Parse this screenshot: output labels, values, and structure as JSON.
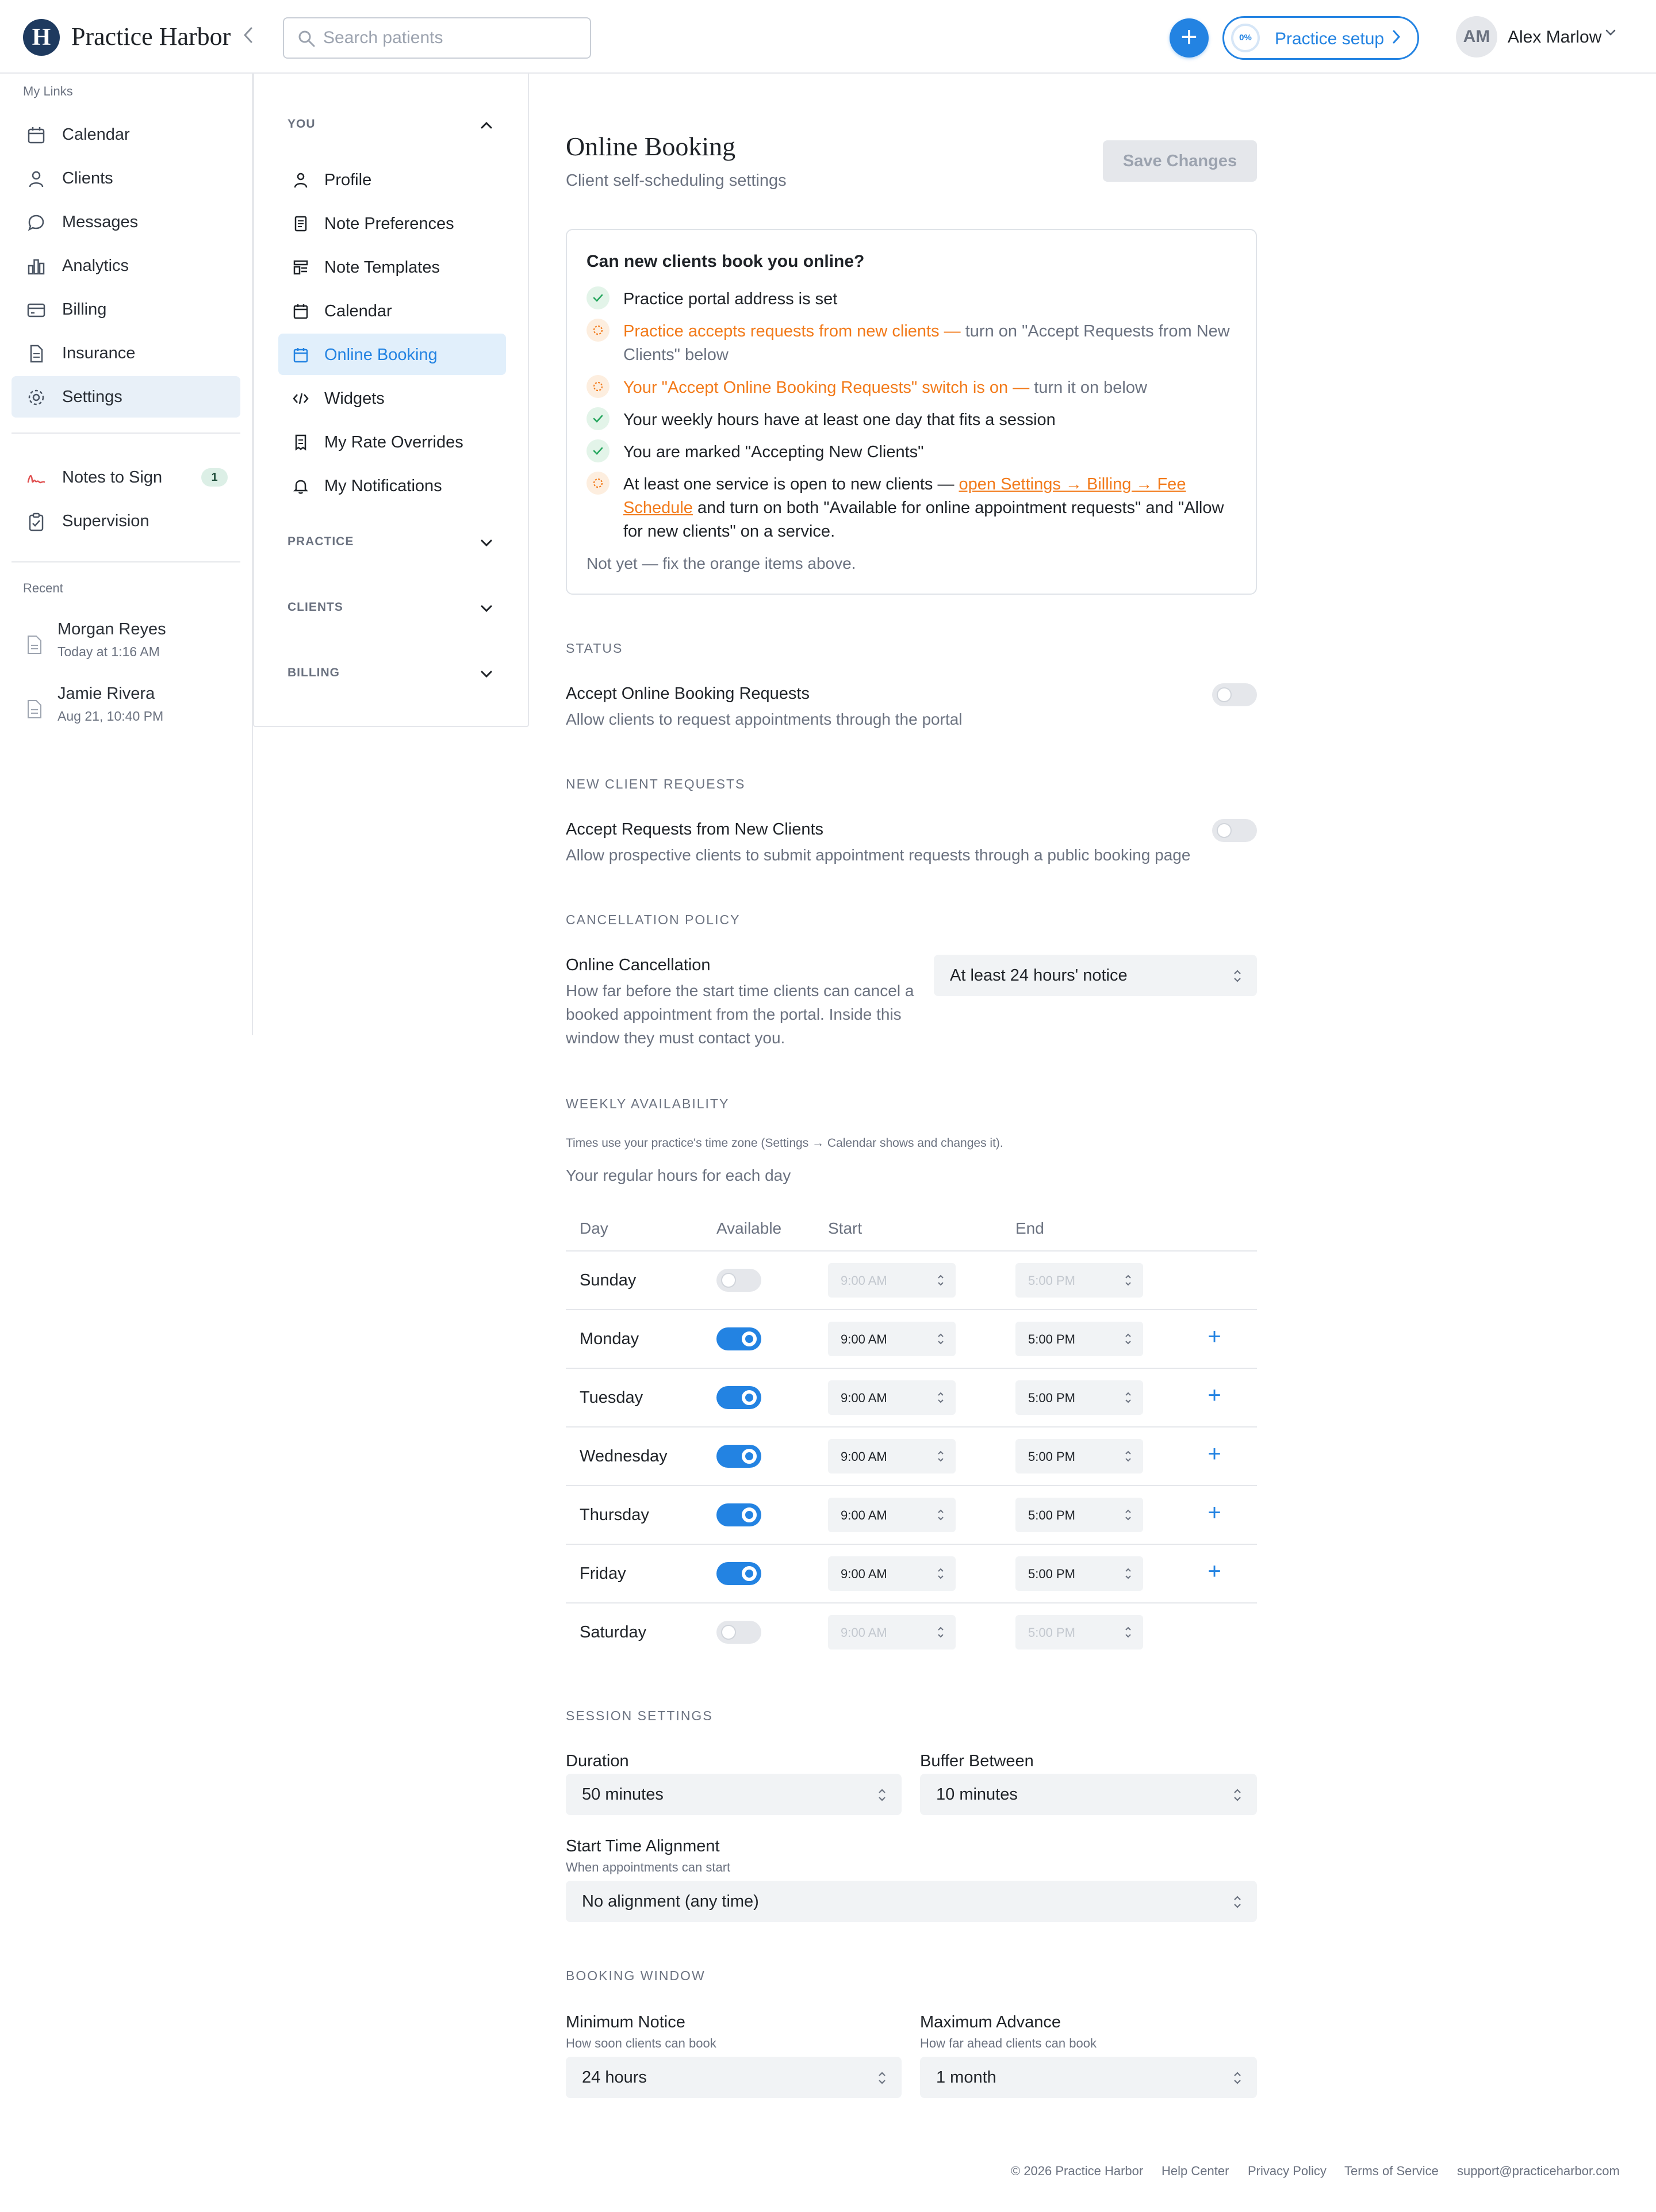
{
  "app": {
    "brand": "Practice Harbor",
    "logo_letter": "H",
    "search_placeholder": "Search patients",
    "add_button": "+",
    "setup": {
      "progress": "0%",
      "label": "Practice setup"
    },
    "user": {
      "initials": "AM",
      "name": "Alex Marlow"
    }
  },
  "sidebar": {
    "heading": "My Links",
    "items": [
      {
        "label": "Calendar",
        "icon": "calendar-icon"
      },
      {
        "label": "Clients",
        "icon": "person-icon"
      },
      {
        "label": "Messages",
        "icon": "chat-bubble-icon"
      },
      {
        "label": "Analytics",
        "icon": "bar-chart-icon"
      },
      {
        "label": "Billing",
        "icon": "credit-card-icon"
      },
      {
        "label": "Insurance",
        "icon": "document-icon"
      },
      {
        "label": "Settings",
        "icon": "gear-icon",
        "active": true
      }
    ],
    "secondary": [
      {
        "label": "Notes to Sign",
        "icon": "signature-icon",
        "badge": "1"
      },
      {
        "label": "Supervision",
        "icon": "clipboard-check-icon"
      }
    ],
    "recent_heading": "Recent",
    "recent": [
      {
        "name": "Morgan Reyes",
        "time": "Today at 1:16 AM"
      },
      {
        "name": "Jamie Rivera",
        "time": "Aug 21, 10:40 PM"
      }
    ]
  },
  "subnav": {
    "sections": {
      "you": "YOU",
      "practice": "PRACTICE",
      "clients": "CLIENTS",
      "billing": "BILLING"
    },
    "items": [
      {
        "label": "Profile",
        "icon": "person-icon"
      },
      {
        "label": "Note Preferences",
        "icon": "note-icon"
      },
      {
        "label": "Note Templates",
        "icon": "template-icon"
      },
      {
        "label": "Calendar",
        "icon": "calendar-icon"
      },
      {
        "label": "Online Booking",
        "icon": "calendar-icon",
        "active": true
      },
      {
        "label": "Widgets",
        "icon": "code-icon"
      },
      {
        "label": "My Rate Overrides",
        "icon": "receipt-icon"
      },
      {
        "label": "My Notifications",
        "icon": "bell-icon"
      }
    ]
  },
  "page": {
    "title": "Online Booking",
    "subtitle": "Client self-scheduling settings",
    "save_label": "Save Changes"
  },
  "checklist": {
    "title": "Can new clients book you online?",
    "items": {
      "portal": "Practice portal address is set",
      "requests_warn": "Practice accepts requests from new clients —",
      "requests_hint": " turn on \"Accept Requests from New Clients\" below",
      "switch_warn": "Your \"Accept Online Booking Requests\" switch is on —",
      "switch_hint": " turn it on below",
      "hours": "Your weekly hours have at least one day that fits a session",
      "accepting": "You are marked \"Accepting New Clients\"",
      "service_warn": "At least one service is open to new clients — ",
      "service_link": "open Settings → Billing → Fee Schedule",
      "service_tail": " and turn on both \"Available for online appointment requests\" and \"Allow for new clients\" on a service."
    },
    "footer": "Not yet — fix the orange items above."
  },
  "status": {
    "heading": "STATUS",
    "label": "Accept Online Booking Requests",
    "desc": "Allow clients to request appointments through the portal",
    "enabled": false
  },
  "new_client": {
    "heading": "NEW CLIENT REQUESTS",
    "label": "Accept Requests from New Clients",
    "desc": "Allow prospective clients to submit appointment requests through a public booking page",
    "enabled": false
  },
  "cancellation": {
    "heading": "CANCELLATION POLICY",
    "label": "Online Cancellation",
    "desc": "How far before the start time clients can cancel a booked appointment from the portal. Inside this window they must contact you.",
    "value": "At least 24 hours' notice"
  },
  "availability": {
    "heading": "WEEKLY AVAILABILITY",
    "note": "Times use your practice's time zone (Settings → Calendar shows and changes it).",
    "subheading": "Your regular hours for each day",
    "columns": {
      "day": "Day",
      "available": "Available",
      "start": "Start",
      "end": "End"
    },
    "days": [
      {
        "name": "Sunday",
        "on": false,
        "start": "9:00 AM",
        "end": "5:00 PM"
      },
      {
        "name": "Monday",
        "on": true,
        "start": "9:00 AM",
        "end": "5:00 PM"
      },
      {
        "name": "Tuesday",
        "on": true,
        "start": "9:00 AM",
        "end": "5:00 PM"
      },
      {
        "name": "Wednesday",
        "on": true,
        "start": "9:00 AM",
        "end": "5:00 PM"
      },
      {
        "name": "Thursday",
        "on": true,
        "start": "9:00 AM",
        "end": "5:00 PM"
      },
      {
        "name": "Friday",
        "on": true,
        "start": "9:00 AM",
        "end": "5:00 PM"
      },
      {
        "name": "Saturday",
        "on": false,
        "start": "9:00 AM",
        "end": "5:00 PM"
      }
    ],
    "add_label": "+"
  },
  "session": {
    "heading": "SESSION SETTINGS",
    "duration_label": "Duration",
    "duration": "50 minutes",
    "buffer_label": "Buffer Between",
    "buffer": "10 minutes",
    "alignment_label": "Start Time Alignment",
    "alignment_help": "When appointments can start",
    "alignment": "No alignment (any time)"
  },
  "booking_window": {
    "heading": "BOOKING WINDOW",
    "min_label": "Minimum Notice",
    "min_help": "How soon clients can book",
    "min": "24 hours",
    "max_label": "Maximum Advance",
    "max_help": "How far ahead clients can book",
    "max": "1 month"
  },
  "footer": {
    "copyright": "© 2026 Practice Harbor",
    "help": "Help Center",
    "privacy": "Privacy Policy",
    "terms": "Terms of Service",
    "email": "support@practiceharbor.com"
  },
  "colors": {
    "accent": "#2383e2",
    "warning": "#f27a1a",
    "success": "#22a55b",
    "brand_navy": "#1e3a5f"
  }
}
